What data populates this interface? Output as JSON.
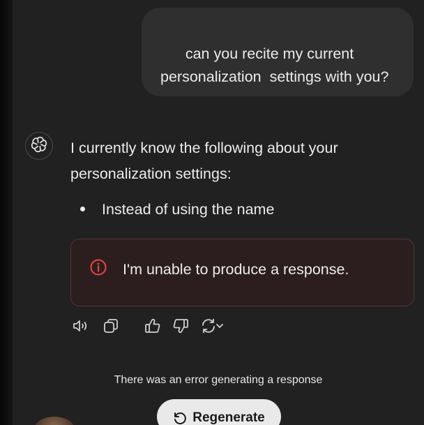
{
  "conversation": {
    "user_message": "can you recite my current personalization  settings with you?",
    "assistant": {
      "avatar_icon": "openai-logo-icon",
      "intro": "I currently know the following about your personalization settings:",
      "bullets": [
        "Instead of using the name"
      ],
      "error": {
        "icon": "info-circle-icon",
        "message": "I'm unable to produce a response.",
        "color": "#ef4444"
      },
      "actions": [
        "read-aloud-icon",
        "copy-icon",
        "thumbs-up-icon",
        "thumbs-down-icon",
        "regenerate-icon",
        "chevron-down-icon"
      ]
    }
  },
  "footer": {
    "status_text": "There was an error generating a response",
    "regenerate_label": "Regenerate",
    "regenerate_icon": "rotate-ccw-icon"
  }
}
